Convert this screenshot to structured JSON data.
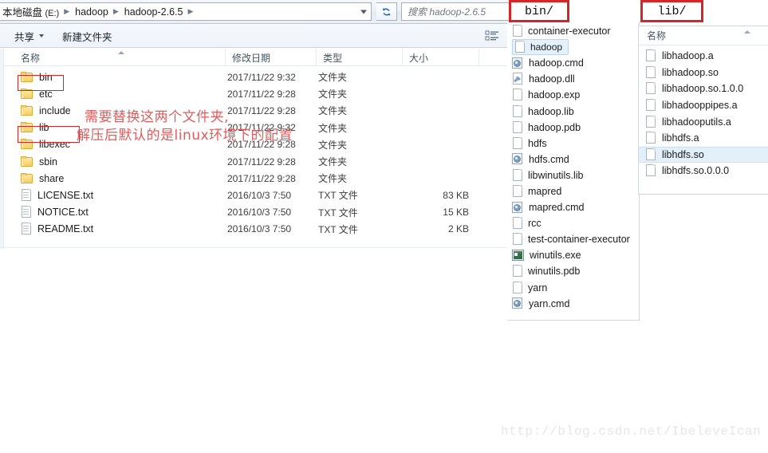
{
  "explorer": {
    "address": {
      "drive_label": "本地磁盘",
      "drive_letter": "(E:)",
      "crumbs": [
        "hadoop",
        "hadoop-2.6.5"
      ],
      "dropdown_icon": "chevron-down-icon",
      "refresh_icon": "refresh-icon"
    },
    "search": {
      "placeholder": "搜索 hadoop-2.6.5",
      "icon": "search-icon"
    },
    "toolbar": {
      "share_label": "共享",
      "new_folder_label": "新建文件夹",
      "view_icon": "list-view-icon"
    },
    "columns": [
      "名称",
      "修改日期",
      "类型",
      "大小"
    ],
    "rows": [
      {
        "name": "bin",
        "icon": "folder-icon",
        "date": "2017/11/22 9:32",
        "type": "文件夹",
        "size": "",
        "highlight": true
      },
      {
        "name": "etc",
        "icon": "folder-icon",
        "date": "2017/11/22 9:28",
        "type": "文件夹",
        "size": "",
        "highlight": false
      },
      {
        "name": "include",
        "icon": "folder-icon",
        "date": "2017/11/22 9:28",
        "type": "文件夹",
        "size": "",
        "highlight": false
      },
      {
        "name": "lib",
        "icon": "folder-icon",
        "date": "2017/11/22 9:32",
        "type": "文件夹",
        "size": "",
        "highlight": true
      },
      {
        "name": "libexec",
        "icon": "folder-icon",
        "date": "2017/11/22 9:28",
        "type": "文件夹",
        "size": "",
        "highlight": false
      },
      {
        "name": "sbin",
        "icon": "folder-icon",
        "date": "2017/11/22 9:28",
        "type": "文件夹",
        "size": "",
        "highlight": false
      },
      {
        "name": "share",
        "icon": "folder-icon",
        "date": "2017/11/22 9:28",
        "type": "文件夹",
        "size": "",
        "highlight": false
      },
      {
        "name": "LICENSE.txt",
        "icon": "text-file-icon",
        "date": "2016/10/3 7:50",
        "type": "TXT 文件",
        "size": "83 KB",
        "highlight": false
      },
      {
        "name": "NOTICE.txt",
        "icon": "text-file-icon",
        "date": "2016/10/3 7:50",
        "type": "TXT 文件",
        "size": "15 KB",
        "highlight": false
      },
      {
        "name": "README.txt",
        "icon": "text-file-icon",
        "date": "2016/10/3 7:50",
        "type": "TXT 文件",
        "size": "2 KB",
        "highlight": false
      }
    ]
  },
  "annotations": {
    "line1": "需要替换这两个文件夹,",
    "line2": "解压后默认的是linux环境下的配置",
    "color": "#e05c5c",
    "box_color": "#d42626"
  },
  "bin_panel": {
    "label": "bin/",
    "items": [
      {
        "name": "container-executor",
        "icon": "blank-file-icon",
        "selected": false
      },
      {
        "name": "hadoop",
        "icon": "blank-file-icon",
        "selected": true
      },
      {
        "name": "hadoop.cmd",
        "icon": "cmd-script-icon",
        "selected": false
      },
      {
        "name": "hadoop.dll",
        "icon": "dll-file-icon",
        "selected": false
      },
      {
        "name": "hadoop.exp",
        "icon": "blank-file-icon",
        "selected": false
      },
      {
        "name": "hadoop.lib",
        "icon": "blank-file-icon",
        "selected": false
      },
      {
        "name": "hadoop.pdb",
        "icon": "blank-file-icon",
        "selected": false
      },
      {
        "name": "hdfs",
        "icon": "blank-file-icon",
        "selected": false
      },
      {
        "name": "hdfs.cmd",
        "icon": "cmd-script-icon",
        "selected": false
      },
      {
        "name": "libwinutils.lib",
        "icon": "blank-file-icon",
        "selected": false
      },
      {
        "name": "mapred",
        "icon": "blank-file-icon",
        "selected": false
      },
      {
        "name": "mapred.cmd",
        "icon": "cmd-script-icon",
        "selected": false
      },
      {
        "name": "rcc",
        "icon": "blank-file-icon",
        "selected": false
      },
      {
        "name": "test-container-executor",
        "icon": "blank-file-icon",
        "selected": false
      },
      {
        "name": "winutils.exe",
        "icon": "exe-app-icon",
        "selected": false
      },
      {
        "name": "winutils.pdb",
        "icon": "blank-file-icon",
        "selected": false
      },
      {
        "name": "yarn",
        "icon": "blank-file-icon",
        "selected": false
      },
      {
        "name": "yarn.cmd",
        "icon": "cmd-script-icon",
        "selected": false
      }
    ]
  },
  "lib_panel": {
    "label": "lib/",
    "column_header": "名称",
    "items": [
      {
        "name": "libhadoop.a",
        "icon": "blank-file-icon",
        "selected": false
      },
      {
        "name": "libhadoop.so",
        "icon": "blank-file-icon",
        "selected": false
      },
      {
        "name": "libhadoop.so.1.0.0",
        "icon": "blank-file-icon",
        "selected": false
      },
      {
        "name": "libhadooppipes.a",
        "icon": "blank-file-icon",
        "selected": false
      },
      {
        "name": "libhadooputils.a",
        "icon": "blank-file-icon",
        "selected": false
      },
      {
        "name": "libhdfs.a",
        "icon": "blank-file-icon",
        "selected": false
      },
      {
        "name": "libhdfs.so",
        "icon": "blank-file-icon",
        "selected": true
      },
      {
        "name": "libhdfs.so.0.0.0",
        "icon": "blank-file-icon",
        "selected": false
      }
    ]
  },
  "watermark": {
    "text": "http://blog.csdn.net/IbeleveIcan"
  }
}
